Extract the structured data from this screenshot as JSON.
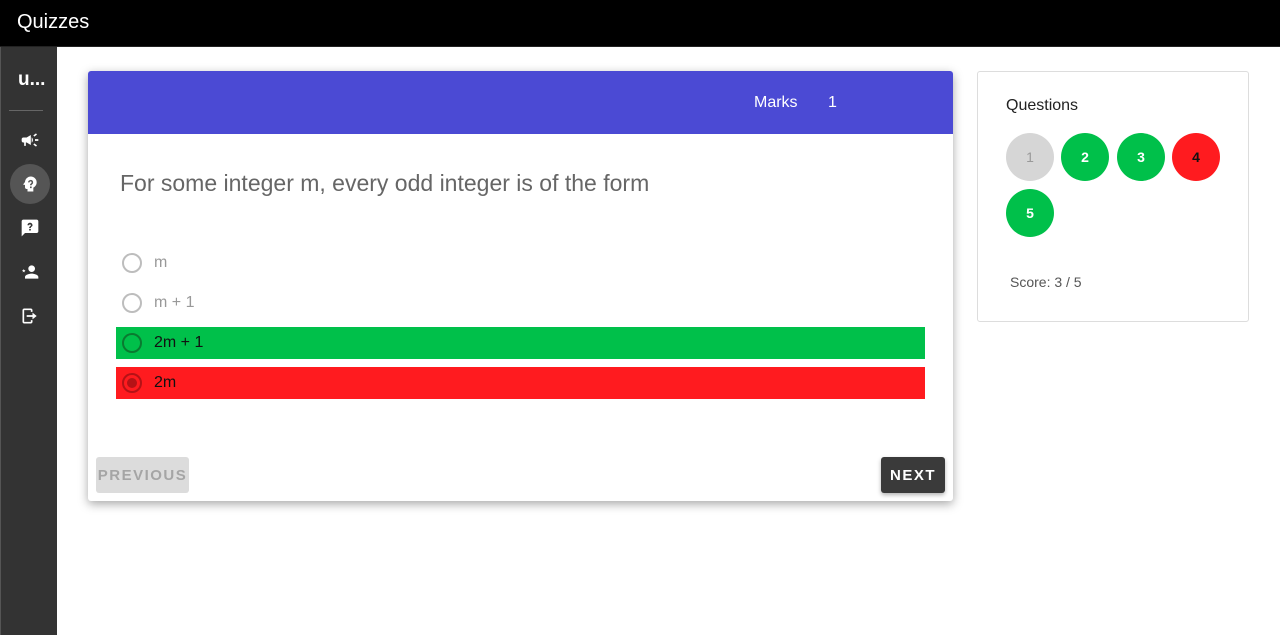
{
  "app": {
    "title": "Quizzes"
  },
  "sidebar": {
    "user_initial": "u..."
  },
  "quiz": {
    "marks_label": "Marks",
    "marks_value": "1",
    "question": "For some integer m, every odd integer is of the form",
    "options": [
      {
        "label": "m",
        "state": "neutral"
      },
      {
        "label": "m + 1",
        "state": "neutral"
      },
      {
        "label": "2m + 1",
        "state": "correct"
      },
      {
        "label": "2m",
        "state": "wrong-selected"
      }
    ],
    "previous_label": "PREVIOUS",
    "next_label": "NEXT"
  },
  "questions_panel": {
    "heading": "Questions",
    "items": [
      {
        "number": "1",
        "status": "unanswered"
      },
      {
        "number": "2",
        "status": "correct"
      },
      {
        "number": "3",
        "status": "correct"
      },
      {
        "number": "4",
        "status": "incorrect"
      },
      {
        "number": "5",
        "status": "correct"
      }
    ],
    "score_text": "Score: 3 / 5"
  },
  "colors": {
    "header": "#4b4ad4",
    "correct": "#00c04a",
    "wrong": "#ff1b1f",
    "sidebar": "#333333",
    "appbar": "#000000"
  }
}
